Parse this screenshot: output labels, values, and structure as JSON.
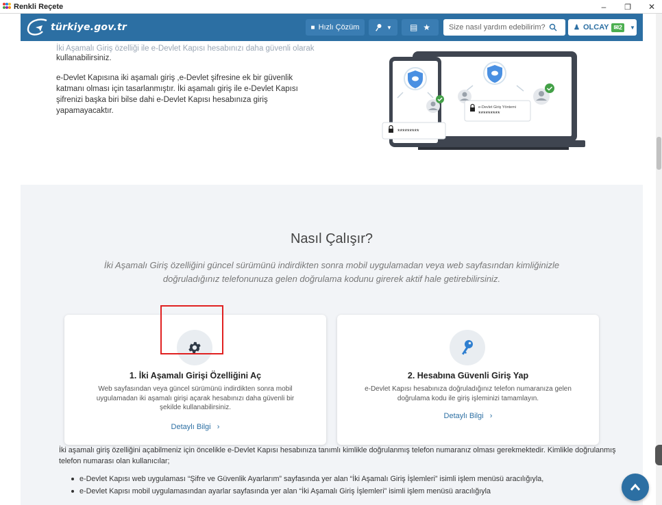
{
  "window": {
    "title": "Renkli Reçete",
    "minimize_glyph": "–",
    "maximize_glyph": "❐",
    "close_glyph": "✕"
  },
  "header": {
    "logo_text": "türkiye.gov.tr",
    "quick_solution_label": "Hızlı Çözüm",
    "search_placeholder": "Size nasıl yardım edebilirim?",
    "user_name": "OLCAY",
    "message_count": "2",
    "brand_color": "#2c6fa3"
  },
  "intro": {
    "faded_line": "İki Aşamalı Giriş özelliği ile e-Devlet Kapısı hesabınızı daha güvenli olarak",
    "line1": "kullanabilirsiniz.",
    "para2": "e-Devlet Kapısına iki aşamalı giriş ,e-Devlet şifresine ek bir güvenlik katmanı olması için tasarlanmıştır. İki aşamalı giriş ile e-Devlet Kapısı şifrenizi başka biri bilse dahi e-Devlet Kapısı hesabınıza giriş yapamayacaktır."
  },
  "illustration": {
    "phone_password": "*********",
    "laptop_label": "e-Devlet Giriş Yöntemi",
    "laptop_password": "*********"
  },
  "how_it_works": {
    "title": "Nasıl Çalışır?",
    "subtitle": "İki Aşamalı Giriş özelliğini güncel sürümünü indirdikten sonra mobil uygulamadan veya web sayfasından kimliğinizle doğruladığınız telefonunuza gelen doğrulama kodunu girerek aktif hale getirebilirsiniz.",
    "cards": [
      {
        "icon": "gear-icon",
        "title": "1. İki Aşamalı Girişi Özelliğini Aç",
        "description": "Web sayfasından veya güncel sürümünü indirdikten sonra mobil uygulamadan iki aşamalı girişi açarak hesabınızı daha güvenli bir şekilde kullanabilirsiniz.",
        "link": "Detaylı Bilgi"
      },
      {
        "icon": "key-icon",
        "title": "2. Hesabına Güvenli Giriş Yap",
        "description": "e-Devlet Kapısı hesabınıza doğruladığınız telefon numaranıza gelen doğrulama kodu ile giriş işleminizi tamamlayın.",
        "link": "Detaylı Bilgi"
      }
    ]
  },
  "bottom": {
    "paragraph": "İki aşamalı giriş özelliğini açabilmeniz için öncelikle e-Devlet Kapısı hesabınıza tanımlı kimlikle doğrulanmış telefon numaranız olması gerekmektedir. Kimlikle doğrulanmış telefon numarası olan kullanıcılar;",
    "bullets": [
      "e-Devlet Kapısı web uygulaması “Şifre ve Güvenlik Ayarlarım” sayfasında yer alan “İki Aşamalı Giriş İşlemleri” isimli işlem menüsü aracılığıyla,",
      "e-Devlet Kapısı mobil uygulamasından ayarlar sayfasında yer alan “İki Aşamalı Giriş İşlemleri” isimli işlem menüsü aracılığıyla"
    ]
  }
}
